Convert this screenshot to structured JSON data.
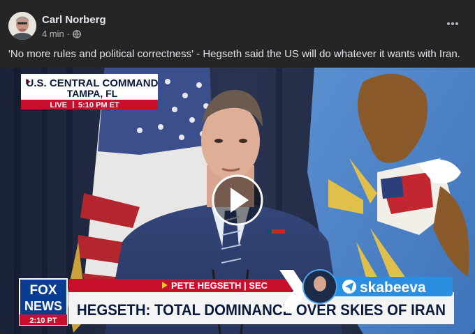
{
  "post": {
    "author": "Carl Norberg",
    "time": "4 min",
    "separator": "·",
    "privacy_icon": "globe-icon",
    "more_icon": "more-options-icon",
    "caption": "'No more rules and political correctness' - Hegseth said the US will do whatever it wants with Iran."
  },
  "video": {
    "location_line1": "U.S. CENTRAL COMMAND",
    "location_line2": "TAMPA, FL",
    "live_label": "LIVE",
    "live_time": "5:10 PM ET",
    "network_line1": "FOX",
    "network_line2": "NEWS",
    "network_time": "2:10 PT",
    "name_bar": "PETE HEGSETH | SEC",
    "headline": "HEGSETH: TOTAL DOMINANCE OVER SKIES OF IRAN",
    "watermark": "skabeeva",
    "play_icon": "play-icon"
  },
  "colors": {
    "card_bg": "#242526",
    "text_primary": "#e4e6eb",
    "text_secondary": "#b0b3b8",
    "fox_red": "#c8102e",
    "fox_blue": "#0a3d91",
    "telegram_blue": "#2aabee"
  }
}
